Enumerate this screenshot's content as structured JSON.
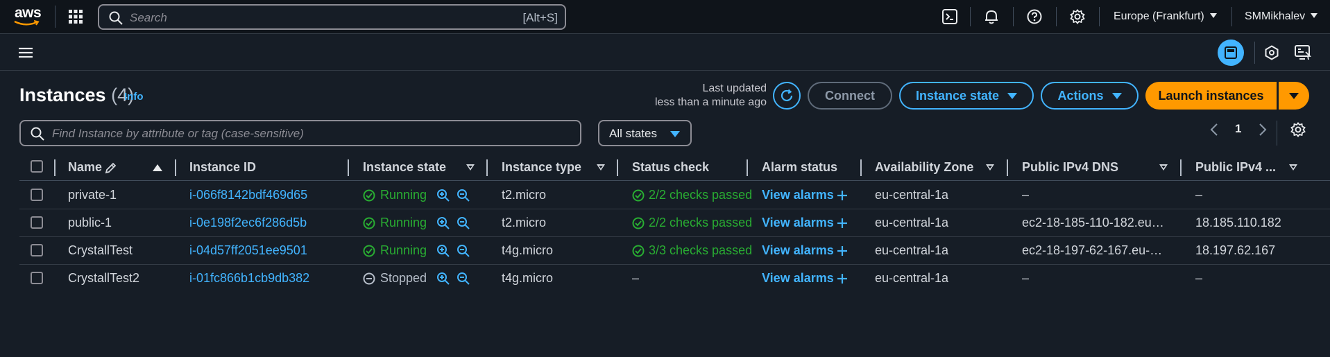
{
  "topnav": {
    "logo": "aws",
    "search_placeholder": "Search",
    "search_shortcut": "[Alt+S]",
    "region": "Europe (Frankfurt)",
    "user": "SMMikhalev",
    "icons": [
      "menu-grid-icon",
      "cloudshell-icon",
      "bell-icon",
      "help-icon",
      "gear-icon"
    ]
  },
  "header": {
    "title": "Instances",
    "count": "(4)",
    "info": "Info",
    "last_updated_line1": "Last updated",
    "last_updated_line2": "less than a minute ago",
    "buttons": {
      "connect": "Connect",
      "instance_state": "Instance state",
      "actions": "Actions",
      "launch": "Launch instances"
    }
  },
  "filter": {
    "placeholder": "Find Instance by attribute or tag (case-sensitive)",
    "states": "All states",
    "page": "1"
  },
  "table": {
    "columns": [
      "Name",
      "Instance ID",
      "Instance state",
      "Instance type",
      "Status check",
      "Alarm status",
      "Availability Zone",
      "Public IPv4 DNS",
      "Public IPv4 ..."
    ],
    "rows": [
      {
        "name": "private-1",
        "id": "i-066f8142bdf469d65",
        "state": "Running",
        "type": "t2.micro",
        "status": "2/2 checks passed",
        "alarm": "View alarms",
        "az": "eu-central-1a",
        "dns": "–",
        "ip": "–"
      },
      {
        "name": "public-1",
        "id": "i-0e198f2ec6f286d5b",
        "state": "Running",
        "type": "t2.micro",
        "status": "2/2 checks passed",
        "alarm": "View alarms",
        "az": "eu-central-1a",
        "dns": "ec2-18-185-110-182.eu…",
        "ip": "18.185.110.182"
      },
      {
        "name": "CrystallTest",
        "id": "i-04d57ff2051ee9501",
        "state": "Running",
        "type": "t4g.micro",
        "status": "3/3 checks passed",
        "alarm": "View alarms",
        "az": "eu-central-1a",
        "dns": "ec2-18-197-62-167.eu-…",
        "ip": "18.197.62.167"
      },
      {
        "name": "CrystallTest2",
        "id": "i-01fc866b1cb9db382",
        "state": "Stopped",
        "type": "t4g.micro",
        "status": "–",
        "alarm": "View alarms",
        "az": "eu-central-1a",
        "dns": "–",
        "ip": "–"
      }
    ]
  },
  "colors": {
    "accent": "#42b4ff",
    "launch": "#ff9900",
    "running": "#29ad32",
    "background": "#161d26"
  }
}
